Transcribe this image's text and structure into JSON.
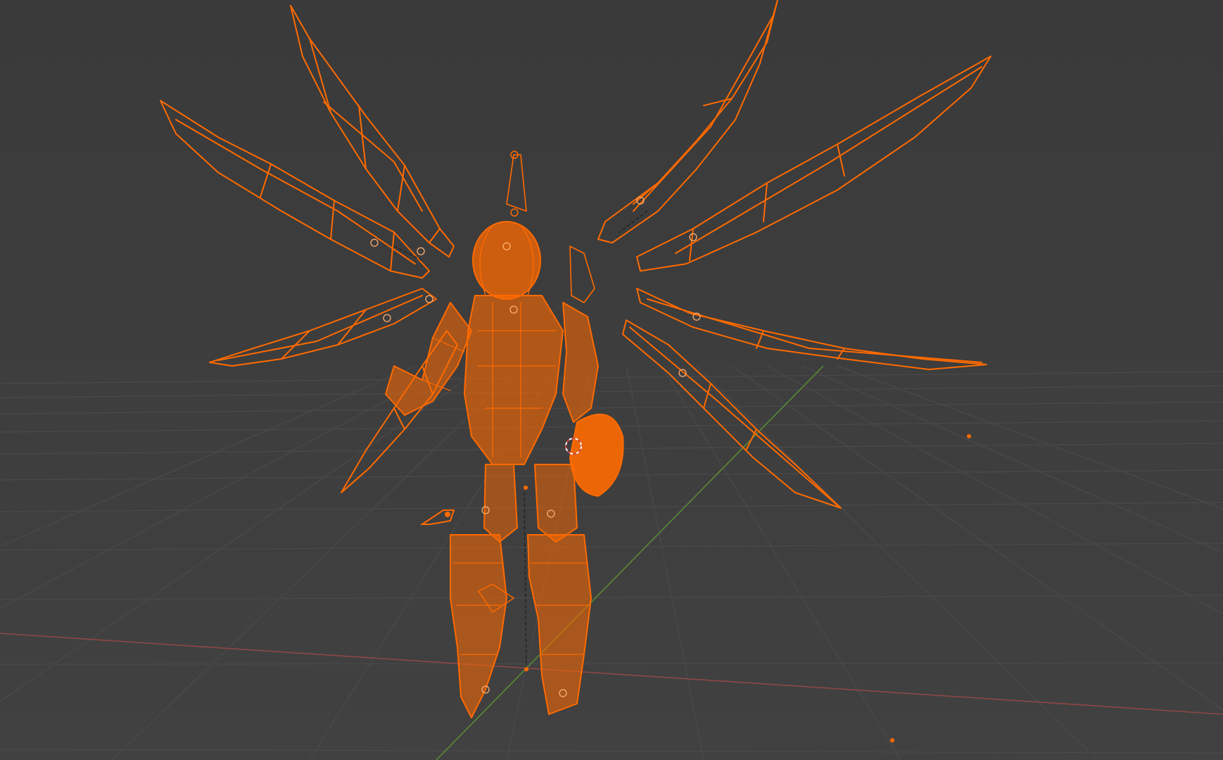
{
  "viewport": {
    "background_top": "#3b3b3b",
    "background_bottom": "#404040",
    "grid_color": "#4a4a4a",
    "x_axis_color": "#9a4a4a",
    "y_axis_color": "#5f8a3a",
    "selection_color": "#ff6a00",
    "selection_highlight": "#ff8c2a"
  },
  "scene": {
    "selected_object": "armature-rig-with-wings",
    "view": "perspective",
    "shading": "wireframe-overlay"
  },
  "icons": {
    "cursor": "3d-cursor-icon",
    "light": "light-object-icon",
    "camera": "camera-object-icon"
  }
}
